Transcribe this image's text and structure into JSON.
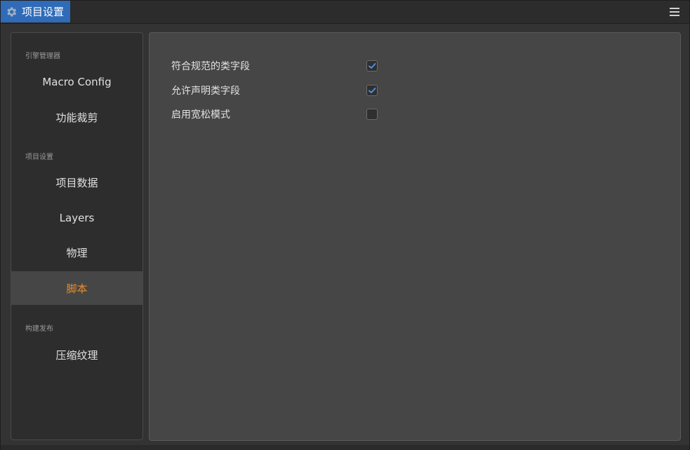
{
  "window": {
    "tab_title": "项目设置",
    "tab_icon": "gear-icon",
    "menu_icon": "hamburger-menu-icon",
    "accent_color": "#2f6bb8",
    "active_color": "#e88f2c"
  },
  "sidebar": {
    "sections": [
      {
        "label": "引擎管理器"
      },
      {
        "label": "项目设置"
      },
      {
        "label": "构建发布"
      }
    ],
    "items": [
      {
        "label": "Macro Config"
      },
      {
        "label": "功能裁剪"
      },
      {
        "label": "项目数据"
      },
      {
        "label": "Layers"
      },
      {
        "label": "物理"
      },
      {
        "label": "脚本",
        "active": true
      },
      {
        "label": "压缩纹理"
      }
    ]
  },
  "script_settings": {
    "options": [
      {
        "label": "符合规范的类字段",
        "checked": true
      },
      {
        "label": "允许声明类字段",
        "checked": true
      },
      {
        "label": "启用宽松模式",
        "checked": false
      }
    ]
  }
}
